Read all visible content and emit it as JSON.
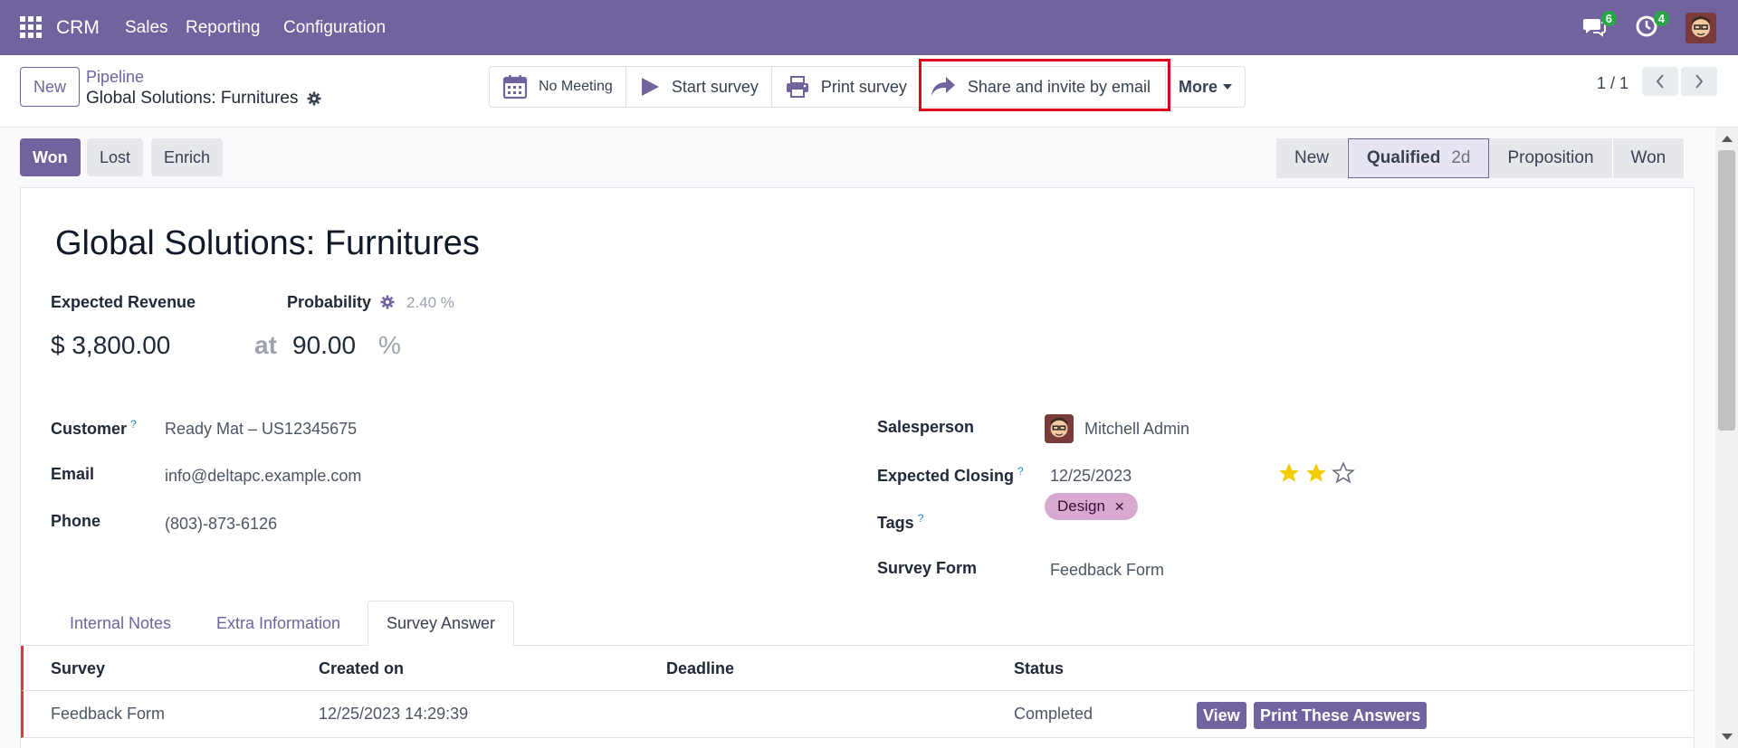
{
  "topbar": {
    "brand": "CRM",
    "menu": [
      "Sales",
      "Reporting",
      "Configuration"
    ],
    "messages_count": "6",
    "activities_count": "4"
  },
  "control": {
    "new_label": "New",
    "breadcrumb_parent": "Pipeline",
    "breadcrumb_current": "Global Solutions: Furnitures",
    "actions": {
      "no_meeting": "No Meeting",
      "start_survey": "Start survey",
      "print_survey": "Print survey",
      "share": "Share and invite by email",
      "more": "More"
    },
    "pager": "1 / 1"
  },
  "statusbar": {
    "won": "Won",
    "lost": "Lost",
    "enrich": "Enrich",
    "stages": [
      {
        "label": "New",
        "duration": ""
      },
      {
        "label": "Qualified",
        "duration": "2d"
      },
      {
        "label": "Proposition",
        "duration": ""
      },
      {
        "label": "Won",
        "duration": ""
      }
    ]
  },
  "form": {
    "title": "Global Solutions: Furnitures",
    "expected_revenue_label": "Expected Revenue",
    "probability_label": "Probability",
    "automated_probability": "2.40 %",
    "currency": "$",
    "revenue": "3,800.00",
    "at": "at",
    "probability": "90.00",
    "pct": "%",
    "customer_label": "Customer",
    "customer": "Ready Mat – US12345675",
    "email_label": "Email",
    "email": "info@deltapc.example.com",
    "phone_label": "Phone",
    "phone": "(803)-873-6126",
    "salesperson_label": "Salesperson",
    "salesperson": "Mitchell Admin",
    "closing_label": "Expected Closing",
    "closing": "12/25/2023",
    "priority": 2,
    "tags_label": "Tags",
    "tag": "Design",
    "survey_form_label": "Survey Form",
    "survey_form": "Feedback Form",
    "q_mark": "?"
  },
  "tabs": [
    "Internal Notes",
    "Extra Information",
    "Survey Answer"
  ],
  "survey_table": {
    "headers": [
      "Survey",
      "Created on",
      "Deadline",
      "Status"
    ],
    "rows": [
      {
        "survey": "Feedback Form",
        "created_on": "12/25/2023 14:29:39",
        "deadline": "",
        "status": "Completed"
      }
    ],
    "view_label": "View",
    "print_label": "Print These Answers"
  },
  "colors": {
    "brand": "#71639e",
    "highlight": "#e0001b",
    "star": "#f3cc00",
    "tag_bg": "#d8a8d1"
  }
}
